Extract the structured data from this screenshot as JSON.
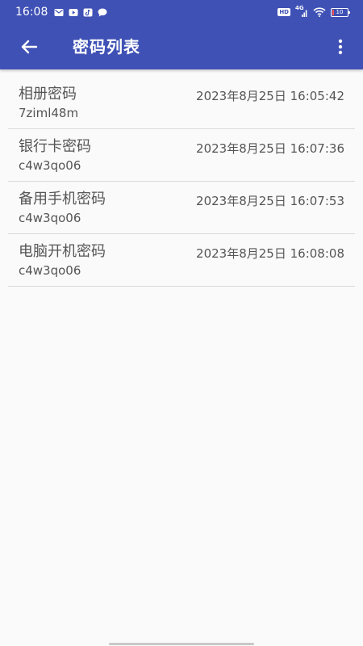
{
  "status_bar": {
    "time": "16:08",
    "hd": "HD",
    "network": "4G",
    "battery": "10",
    "notification_icons": [
      "mail-icon",
      "youtube-icon",
      "tiktok-icon",
      "chat-bubble-icon"
    ]
  },
  "toolbar": {
    "title": "密码列表",
    "back_icon": "back-arrow-icon",
    "overflow_icon": "more-vert-icon",
    "color": "#3f51b5"
  },
  "entries": [
    {
      "name": "相册密码",
      "password": "7ziml48m",
      "date": "2023年8月25日 16:05:42"
    },
    {
      "name": "银行卡密码",
      "password": "c4w3qo06",
      "date": "2023年8月25日 16:07:36"
    },
    {
      "name": "备用手机密码",
      "password": "c4w3qo06",
      "date": "2023年8月25日 16:07:53"
    },
    {
      "name": "电脑开机密码",
      "password": "c4w3qo06",
      "date": "2023年8月25日 16:08:08"
    }
  ]
}
